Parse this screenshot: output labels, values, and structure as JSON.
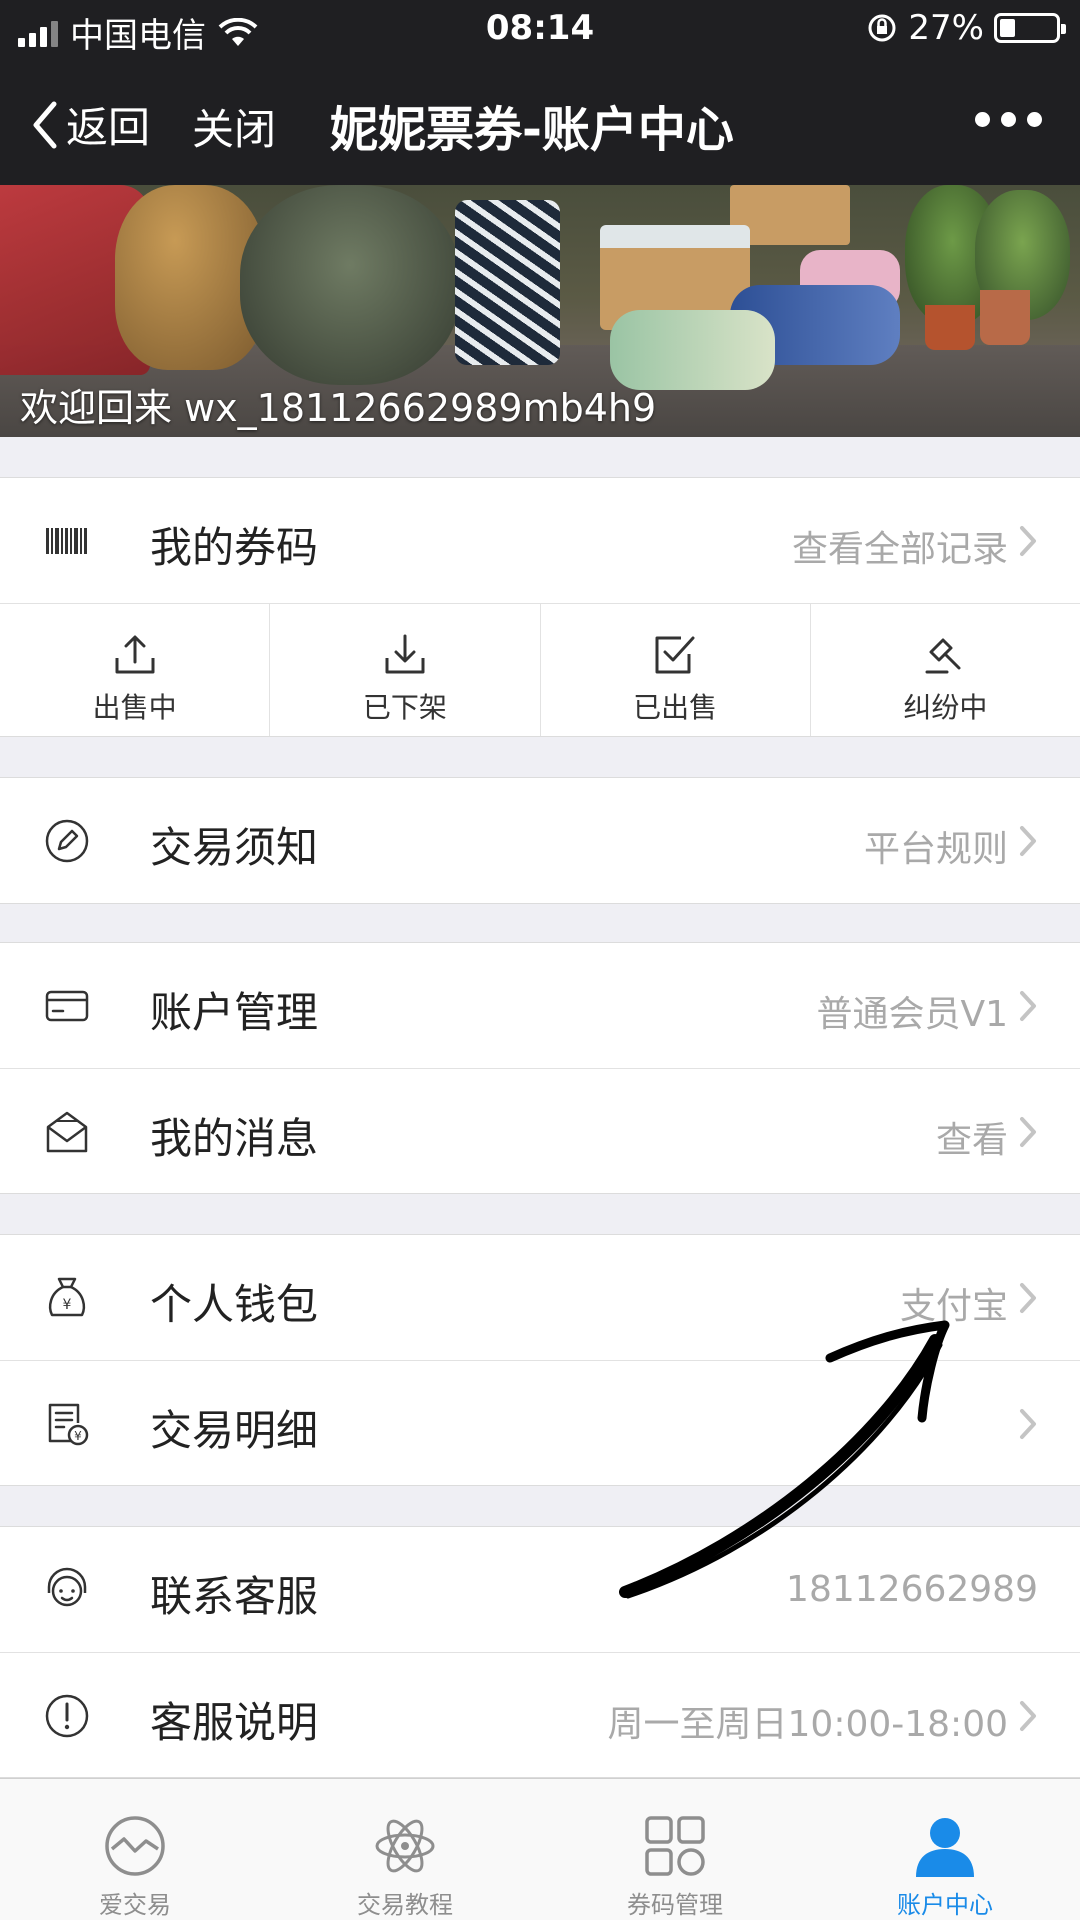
{
  "status_bar": {
    "carrier": "中国电信",
    "time": "08:14",
    "battery_percent": "27%",
    "battery_level": 0.27
  },
  "nav": {
    "back_label": "返回",
    "close_label": "关闭",
    "title": "妮妮票券-账户中心"
  },
  "banner": {
    "welcome": "欢迎回来 wx_18112662989mb4h9"
  },
  "my_codes": {
    "label": "我的券码",
    "value": "查看全部记录",
    "icon": "barcode-icon",
    "status_tabs": [
      {
        "label": "出售中",
        "icon": "upload-icon"
      },
      {
        "label": "已下架",
        "icon": "download-icon"
      },
      {
        "label": "已出售",
        "icon": "checkbox-icon"
      },
      {
        "label": "纠纷中",
        "icon": "gavel-icon"
      }
    ]
  },
  "rows": {
    "trade_notice": {
      "label": "交易须知",
      "value": "平台规则",
      "icon": "pencil-circle-icon"
    },
    "account": {
      "label": "账户管理",
      "value": "普通会员V1",
      "icon": "card-icon"
    },
    "messages": {
      "label": "我的消息",
      "value": "查看",
      "icon": "mail-icon"
    },
    "wallet": {
      "label": "个人钱包",
      "value": "支付宝",
      "icon": "money-bag-icon"
    },
    "details": {
      "label": "交易明细",
      "value": "",
      "icon": "receipt-icon"
    },
    "support": {
      "label": "联系客服",
      "value": "18112662989",
      "icon": "headset-icon"
    },
    "service_info": {
      "label": "客服说明",
      "value": "周一至周日10:00-18:00",
      "icon": "info-circle-icon"
    }
  },
  "tabbar": {
    "items": [
      {
        "label": "爱交易",
        "icon": "trade-icon",
        "active": false
      },
      {
        "label": "交易教程",
        "icon": "atom-icon",
        "active": false
      },
      {
        "label": "券码管理",
        "icon": "grid-icon",
        "active": false
      },
      {
        "label": "账户中心",
        "icon": "user-icon",
        "active": true
      }
    ]
  },
  "colors": {
    "nav_bg": "#1f1f22",
    "page_bg": "#efeff4",
    "value_text": "#a9a9a9",
    "active_tab": "#1a8be8",
    "inactive_tab": "#8e8e8e"
  }
}
